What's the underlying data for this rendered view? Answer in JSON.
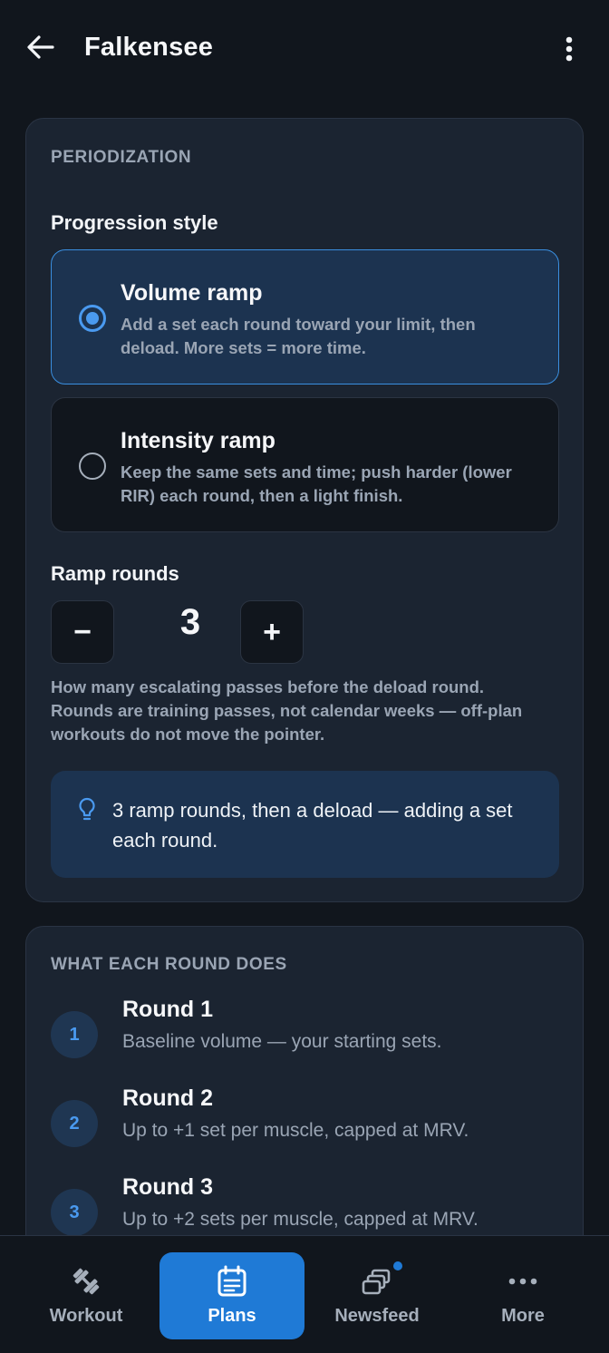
{
  "header": {
    "title": "Falkensee",
    "back_icon": "arrow-left-icon",
    "menu_icon": "more-vertical-icon"
  },
  "periodization": {
    "section_label": "PERIODIZATION",
    "progression_label": "Progression style",
    "options": [
      {
        "title": "Volume ramp",
        "description": "Add a set each round toward your limit, then deload. More sets = more time.",
        "selected": true
      },
      {
        "title": "Intensity ramp",
        "description": "Keep the same sets and time; push harder (lower RIR) each round, then a light finish.",
        "selected": false
      }
    ],
    "ramp_rounds_label": "Ramp rounds",
    "ramp_rounds_value": "3",
    "decrement_label": "−",
    "increment_label": "+",
    "help_text": "How many escalating passes before the deload round. Rounds are training passes, not calendar weeks — off-plan workouts do not move the pointer.",
    "tip_text": "3 ramp rounds, then a deload — adding a set each round.",
    "tip_icon": "lightbulb-icon"
  },
  "rounds": {
    "section_label": "WHAT EACH ROUND DOES",
    "items": [
      {
        "number": "1",
        "title": "Round 1",
        "description": "Baseline volume — your starting sets."
      },
      {
        "number": "2",
        "title": "Round 2",
        "description": "Up to +1 set per muscle, capped at MRV."
      },
      {
        "number": "3",
        "title": "Round 3",
        "description": "Up to +2 sets per muscle, capped at MRV."
      }
    ]
  },
  "nav": {
    "items": [
      {
        "label": "Workout",
        "icon": "dumbbell-icon",
        "active": false
      },
      {
        "label": "Plans",
        "icon": "calendar-icon",
        "active": true
      },
      {
        "label": "Newsfeed",
        "icon": "layers-icon",
        "active": false,
        "badge": true
      },
      {
        "label": "More",
        "icon": "more-horizontal-icon",
        "active": false
      }
    ]
  },
  "colors": {
    "background": "#11161d",
    "card": "#1b2431",
    "accent": "#1f7ad6",
    "accent_light": "#4a9af0",
    "muted_text": "#9aa5b4"
  }
}
